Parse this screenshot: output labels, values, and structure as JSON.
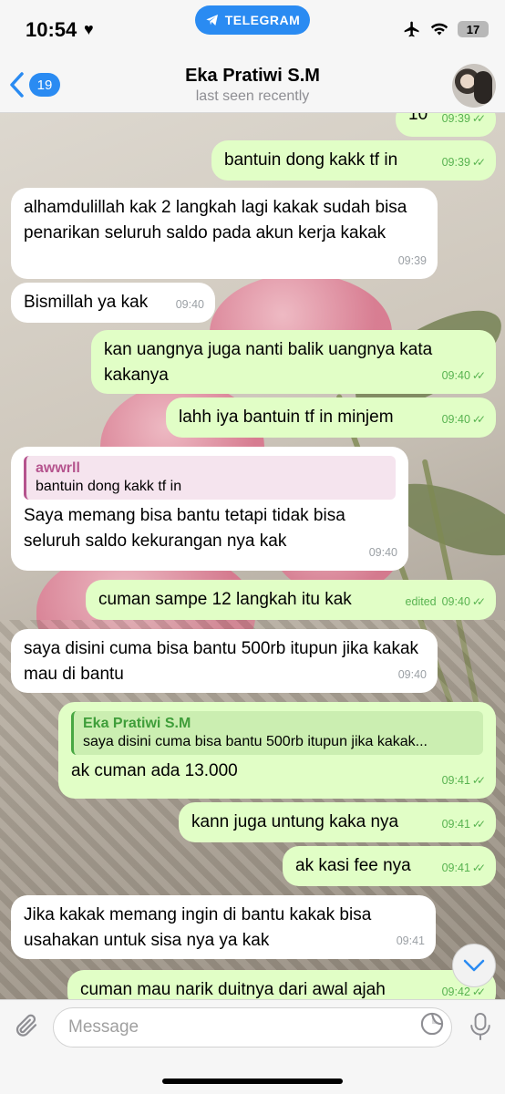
{
  "status_bar": {
    "time": "10:54",
    "app_pill": "TELEGRAM",
    "battery": "17"
  },
  "header": {
    "back_count": "19",
    "name": "Eka Pratiwi S.M",
    "subtitle": "last seen recently"
  },
  "messages": [
    {
      "dir": "out",
      "text": "10",
      "time": "09:39"
    },
    {
      "dir": "out",
      "text": "bantuin dong kakk tf in",
      "time": "09:39"
    },
    {
      "dir": "in",
      "text": "alhamdulillah kak 2 langkah lagi kakak sudah bisa penarikan seluruh saldo pada akun kerja kakak",
      "time": "09:39"
    },
    {
      "dir": "in",
      "text": "Bismillah ya kak",
      "time": "09:40"
    },
    {
      "dir": "out",
      "text": "kan uangnya juga nanti balik uangnya kata kakanya",
      "time": "09:40"
    },
    {
      "dir": "out",
      "text": "lahh iya bantuin tf in minjem",
      "time": "09:40"
    },
    {
      "dir": "in",
      "reply_name": "awwrll",
      "reply_text": "bantuin dong kakk tf in",
      "text": "Saya memang bisa bantu tetapi tidak bisa seluruh saldo kekurangan nya kak",
      "time": "09:40"
    },
    {
      "dir": "out",
      "text": "cuman sampe 12 langkah itu kak",
      "edited": "edited",
      "time": "09:40"
    },
    {
      "dir": "in",
      "text": "saya disini cuma bisa bantu 500rb itupun jika kakak mau di bantu",
      "time": "09:40"
    },
    {
      "dir": "out",
      "reply_name": "Eka Pratiwi S.M",
      "reply_text": "saya disini cuma bisa bantu 500rb itupun jika kakak...",
      "text": "ak cuman ada 13.000",
      "time": "09:41"
    },
    {
      "dir": "out",
      "text": "kann juga untung kaka nya",
      "time": "09:41"
    },
    {
      "dir": "out",
      "text": "ak kasi fee nya",
      "time": "09:41"
    },
    {
      "dir": "in",
      "text": "Jika kakak memang ingin di bantu kakak bisa usahakan untuk sisa nya ya kak",
      "time": "09:41"
    },
    {
      "dir": "out",
      "text": "cuman mau narik duitnya dari awal ajah",
      "time": "09:42"
    }
  ],
  "composer": {
    "placeholder": "Message"
  },
  "icons": {
    "back": "chevron-left-icon",
    "attach": "paperclip-icon",
    "sticker": "sticker-icon",
    "mic": "microphone-icon",
    "scroll": "chevron-down-icon"
  },
  "colors": {
    "accent": "#2a8bf2",
    "outgoing_bubble": "#e1fec6",
    "incoming_bubble": "#ffffff",
    "read_ticks": "#58b350"
  }
}
